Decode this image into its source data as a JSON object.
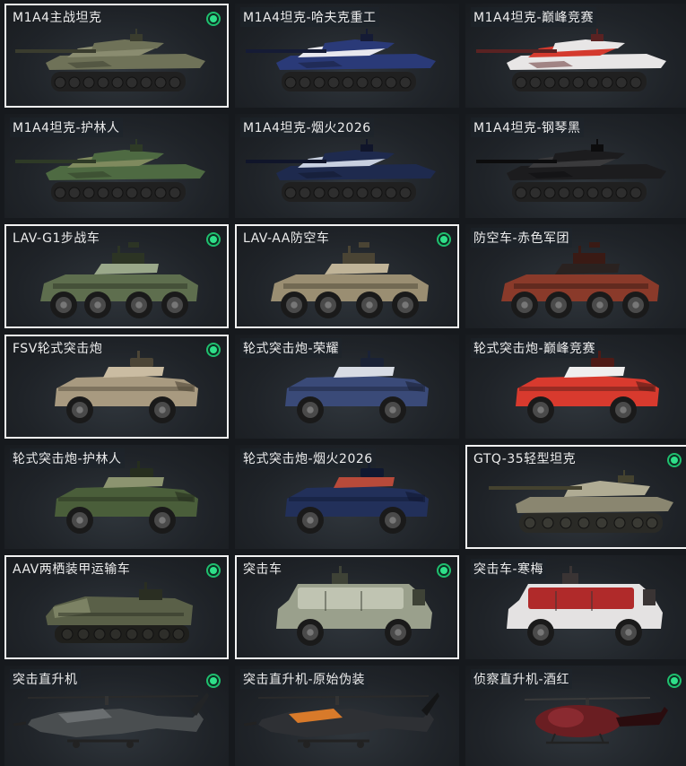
{
  "vehicles": [
    {
      "label": "M1A4主战坦克",
      "type": "tank",
      "selected": true,
      "owned": true,
      "colors": {
        "body": "#6f7258",
        "accent": "#8a8c70",
        "dark": "#3a3c2e"
      }
    },
    {
      "label": "M1A4坦克-哈夫克重工",
      "type": "tank",
      "selected": false,
      "owned": false,
      "colors": {
        "body": "#2a3a78",
        "accent": "#e8e8ee",
        "dark": "#151b35"
      }
    },
    {
      "label": "M1A4坦克-巅峰竞赛",
      "type": "tank",
      "selected": false,
      "owned": false,
      "colors": {
        "body": "#e8e6e6",
        "accent": "#d43a2e",
        "dark": "#5a2222"
      }
    },
    {
      "label": "M1A4坦克-护林人",
      "type": "tank",
      "selected": false,
      "owned": false,
      "colors": {
        "body": "#4e6a42",
        "accent": "#7f8a5e",
        "dark": "#2e3a26"
      }
    },
    {
      "label": "M1A4坦克-烟火2026",
      "type": "tank",
      "selected": false,
      "owned": false,
      "colors": {
        "body": "#1e2a4e",
        "accent": "#c8d0e0",
        "dark": "#10152a"
      }
    },
    {
      "label": "M1A4坦克-钢琴黑",
      "type": "tank",
      "selected": false,
      "owned": false,
      "colors": {
        "body": "#1c1c1e",
        "accent": "#3a3a3c",
        "dark": "#0c0c0d"
      }
    },
    {
      "label": "LAV-G1步战车",
      "type": "apc",
      "selected": true,
      "owned": true,
      "colors": {
        "body": "#5e6e4e",
        "accent": "#9aa88a",
        "dark": "#2c3424"
      }
    },
    {
      "label": "LAV-AA防空车",
      "type": "apc",
      "selected": true,
      "owned": true,
      "colors": {
        "body": "#9a8e72",
        "accent": "#c0b498",
        "dark": "#4a4434"
      }
    },
    {
      "label": "防空车-赤色军团",
      "type": "apc",
      "selected": false,
      "owned": false,
      "colors": {
        "body": "#8a3a2a",
        "accent": "#2a2220",
        "dark": "#3a1a14"
      }
    },
    {
      "label": "FSV轮式突击炮",
      "type": "wheeled",
      "selected": true,
      "owned": true,
      "colors": {
        "body": "#a89a80",
        "accent": "#cabca2",
        "dark": "#4c4536"
      }
    },
    {
      "label": "轮式突击炮-荣耀",
      "type": "wheeled",
      "selected": false,
      "owned": false,
      "colors": {
        "body": "#3a4a78",
        "accent": "#d8dce4",
        "dark": "#1a2236"
      }
    },
    {
      "label": "轮式突击炮-巅峰竞赛",
      "type": "wheeled",
      "selected": false,
      "owned": false,
      "colors": {
        "body": "#d83a2e",
        "accent": "#efeeee",
        "dark": "#4e1a16"
      }
    },
    {
      "label": "轮式突击炮-护林人",
      "type": "wheeled",
      "selected": false,
      "owned": false,
      "colors": {
        "body": "#4a5e3a",
        "accent": "#8c9470",
        "dark": "#262e1e"
      }
    },
    {
      "label": "轮式突击炮-烟火2026",
      "type": "wheeled",
      "selected": false,
      "owned": false,
      "colors": {
        "body": "#22305a",
        "accent": "#b84a3a",
        "dark": "#101830"
      }
    },
    {
      "label": "GTQ-35轻型坦克",
      "type": "lighttank",
      "selected": true,
      "owned": true,
      "colors": {
        "body": "#8a8670",
        "accent": "#b0ac94",
        "dark": "#44422f"
      }
    },
    {
      "label": "AAV两栖装甲运输车",
      "type": "aav",
      "selected": true,
      "owned": true,
      "colors": {
        "body": "#5a6048",
        "accent": "#7c8264",
        "dark": "#2a2e22"
      }
    },
    {
      "label": "突击车",
      "type": "mrap",
      "selected": true,
      "owned": true,
      "colors": {
        "body": "#9aa08c",
        "accent": "#c0c4b2",
        "dark": "#3e4236"
      }
    },
    {
      "label": "突击车-寒梅",
      "type": "mrap",
      "selected": false,
      "owned": false,
      "colors": {
        "body": "#e4e2e2",
        "accent": "#b02a2a",
        "dark": "#3a3434"
      }
    },
    {
      "label": "突击直升机",
      "type": "heli",
      "selected": false,
      "owned": true,
      "colors": {
        "body": "#4a4e50",
        "accent": "#6a6e70",
        "dark": "#222426"
      }
    },
    {
      "label": "突击直升机-原始伪装",
      "type": "heli",
      "selected": false,
      "owned": false,
      "colors": {
        "body": "#2e3034",
        "accent": "#d87a2a",
        "dark": "#141516"
      }
    },
    {
      "label": "侦察直升机-酒红",
      "type": "scout",
      "selected": false,
      "owned": true,
      "colors": {
        "body": "#6a1e22",
        "accent": "#8a2a30",
        "dark": "#2a0c0e"
      }
    }
  ]
}
